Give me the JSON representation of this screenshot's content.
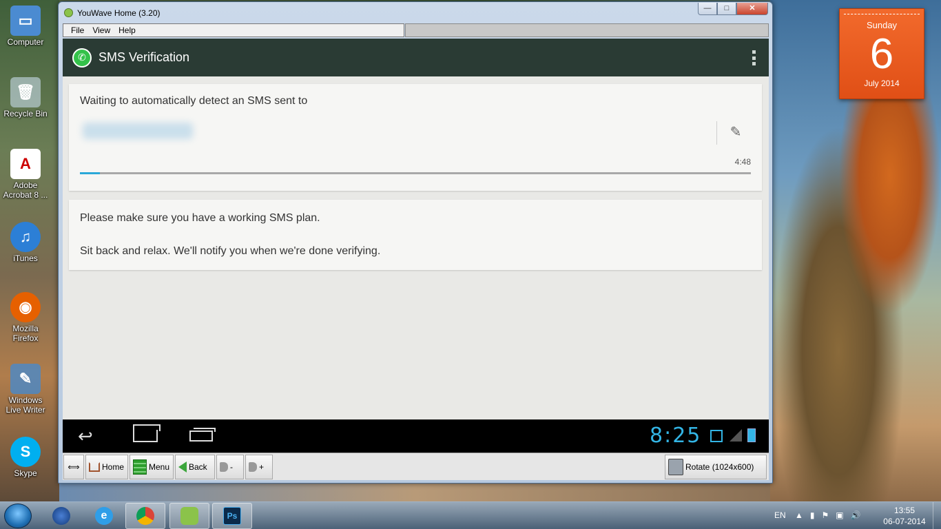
{
  "desktop": {
    "icons": [
      {
        "label": "Computer",
        "icon": "computer-icon"
      },
      {
        "label": "Recycle Bin",
        "icon": "recycle-bin-icon"
      },
      {
        "label": "Adobe Acrobat 8 ...",
        "icon": "adobe-acrobat-icon"
      },
      {
        "label": "iTunes",
        "icon": "itunes-icon"
      },
      {
        "label": "Mozilla Firefox",
        "icon": "firefox-icon"
      },
      {
        "label": "Windows Live Writer",
        "icon": "live-writer-icon"
      },
      {
        "label": "Skype",
        "icon": "skype-icon"
      }
    ],
    "gadget": {
      "day": "Sunday",
      "date": "6",
      "month_year": "July 2014"
    }
  },
  "window": {
    "title": "YouWave Home (3.20)",
    "menu": [
      "File",
      "View",
      "Help"
    ],
    "controls": {
      "minimize": "—",
      "maximize": "□",
      "close": "✕"
    }
  },
  "app": {
    "title": "SMS Verification",
    "card1": {
      "message": "Waiting to automatically detect an SMS sent to",
      "timer": "4:48",
      "progress": 0.03
    },
    "card2": {
      "line1": "Please make sure you have a working SMS plan.",
      "line2": "Sit back and relax. We'll notify you when we're done verifying."
    }
  },
  "android_nav": {
    "clock": "8:25"
  },
  "toolbar": {
    "swap": "⟺",
    "home": "Home",
    "menu": "Menu",
    "back": "Back",
    "vol_down": "-",
    "vol_up": "+",
    "rotate": "Rotate (1024x600)"
  },
  "taskbar": {
    "apps": [
      "start-orb",
      "network-globe",
      "internet-explorer",
      "chrome",
      "youwave-android",
      "photoshop"
    ],
    "lang": "EN",
    "time": "13:55",
    "date": "06-07-2014"
  },
  "colors": {
    "actionbar": "#2a3b34",
    "accent": "#33b5e5",
    "whatsapp_green": "#34c24a",
    "gadget_orange": "#e04f16"
  }
}
